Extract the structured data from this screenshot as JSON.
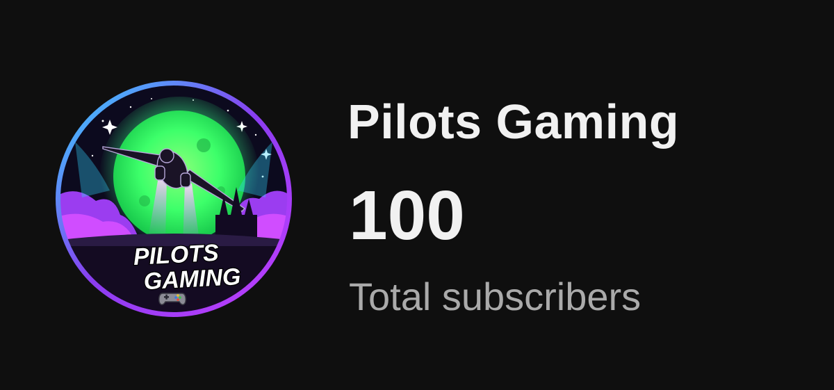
{
  "channel": {
    "name": "Pilots Gaming",
    "subscriber_count": "100",
    "subscriber_label": "Total subscribers"
  },
  "avatar": {
    "logo_text_line1": "PILOTS",
    "logo_text_line2": "GAMING",
    "icon": "gamepad-icon"
  },
  "colors": {
    "background": "#0f0f0f",
    "primary_text": "#f1f1f1",
    "secondary_text": "#aaaaaa",
    "moon_green": "#3dff6a",
    "ring_purple": "#8a3df0",
    "cloud_pink": "#d04dff"
  }
}
